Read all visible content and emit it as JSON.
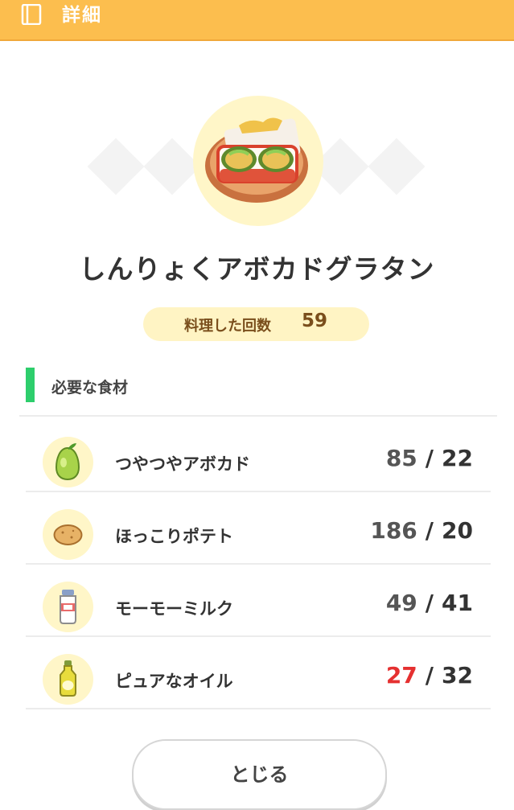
{
  "header": {
    "title": "詳細",
    "icon": "book-icon"
  },
  "dish": {
    "name": "しんりょくアボカドグラタン",
    "icon": "avocado-gratin-icon"
  },
  "cook_count": {
    "label": "料理した回数",
    "value": "59"
  },
  "ingredients": {
    "title": "必要な食材",
    "items": [
      {
        "name": "つやつやアボカド",
        "have": "85",
        "need": "22",
        "icon": "avocado-icon",
        "short": false
      },
      {
        "name": "ほっこりポテト",
        "have": "186",
        "need": "20",
        "icon": "potato-icon",
        "short": false
      },
      {
        "name": "モーモーミルク",
        "have": "49",
        "need": "41",
        "icon": "milk-bottle-icon",
        "short": false
      },
      {
        "name": "ピュアなオイル",
        "have": "27",
        "need": "32",
        "icon": "oil-bottle-icon",
        "short": true
      }
    ]
  },
  "close_button": {
    "label": "とじる"
  },
  "colors": {
    "header": "#fcbe4e",
    "accent": "#2dce6c",
    "shortage": "#e53030",
    "pill": "#fff4c4"
  }
}
